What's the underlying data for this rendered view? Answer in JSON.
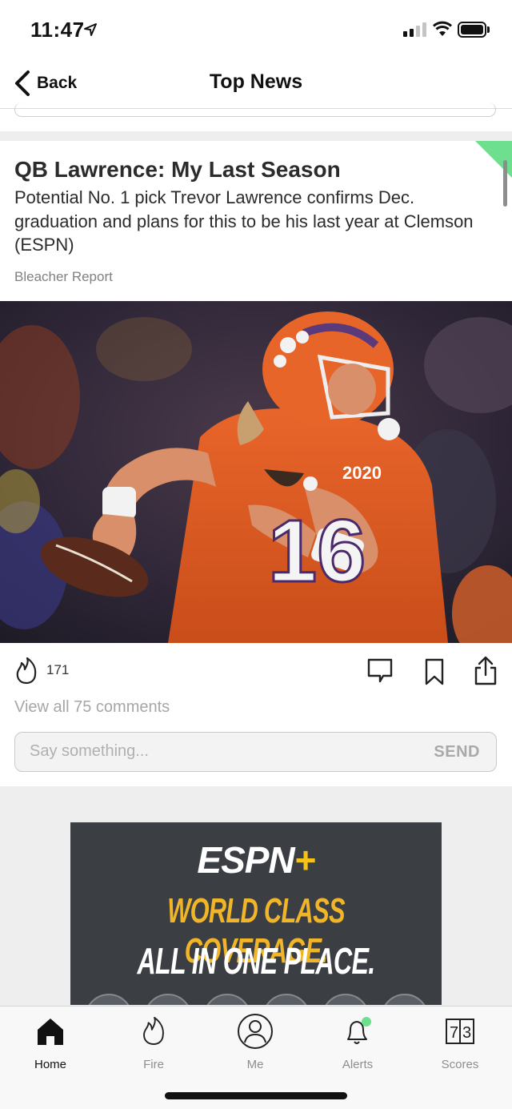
{
  "status_bar": {
    "time": "11:47",
    "icons": [
      "location-arrow-icon",
      "signal-icon",
      "wifi-icon",
      "battery-icon"
    ]
  },
  "nav": {
    "back_label": "Back",
    "title": "Top News"
  },
  "article": {
    "headline": "QB Lawrence: My Last Season",
    "summary": "Potential No. 1 pick Trevor Lawrence confirms Dec. graduation and plans for this to be his last year at Clemson (ESPN)",
    "source": "Bleacher Report",
    "photo": {
      "jersey_number": "16",
      "patch": "2020"
    },
    "fire_count": "171",
    "view_comments": "View all 75 comments",
    "comment_placeholder": "Say something...",
    "send_label": "SEND",
    "accent_color": "#6ddf8e"
  },
  "ad": {
    "logo": "ESPN",
    "logo_plus": "+",
    "line1": "WORLD CLASS COVERAGE.",
    "line2": "ALL IN ONE PLACE.",
    "accent_color": "#f0b528"
  },
  "tabs": [
    {
      "label": "Home",
      "icon": "home-icon",
      "active": true
    },
    {
      "label": "Fire",
      "icon": "fire-icon",
      "active": false
    },
    {
      "label": "Me",
      "icon": "profile-icon",
      "active": false
    },
    {
      "label": "Alerts",
      "icon": "bell-icon",
      "active": false,
      "badge_color": "#6ddf8e"
    },
    {
      "label": "Scores",
      "icon": "scoreboard-icon",
      "active": false,
      "score_digits": [
        "7",
        "3"
      ]
    }
  ]
}
